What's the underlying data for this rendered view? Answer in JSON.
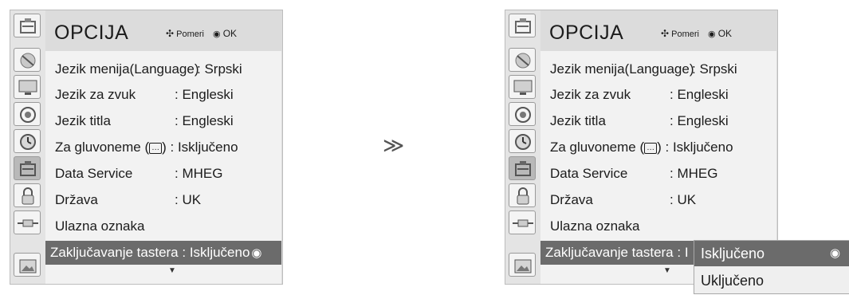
{
  "menu": {
    "title": "OPCIJA",
    "hint_move": "Pomeri",
    "hint_ok": "OK",
    "tabs": [
      "satellite-icon",
      "tv-screen-icon",
      "speaker-icon",
      "clock-icon",
      "option-icon",
      "lock-icon",
      "input-plug-icon",
      "photo-icon"
    ],
    "active_tab": "option-icon",
    "rows": [
      {
        "label": "Jezik menija(Language)",
        "value": ": Srpski"
      },
      {
        "label": "Jezik za zvuk",
        "value": ": Engleski"
      },
      {
        "label": "Jezik titla",
        "value": ": Engleski"
      },
      {
        "label": "Za gluvoneme (",
        "cc": "…",
        "value": ") : Isključeno"
      },
      {
        "label": "Data Service",
        "value": ": MHEG"
      },
      {
        "label": "Država",
        "value": ": UK"
      },
      {
        "label": "Ulazna oznaka",
        "value": ""
      },
      {
        "label": "Zaključavanje tastera",
        "value": ": Isključeno"
      }
    ],
    "right_selected_value_truncated": ": I"
  },
  "arrow_between": "≫",
  "dropdown": {
    "options": [
      "Isključeno",
      "Uključeno"
    ],
    "selected": "Isključeno"
  }
}
